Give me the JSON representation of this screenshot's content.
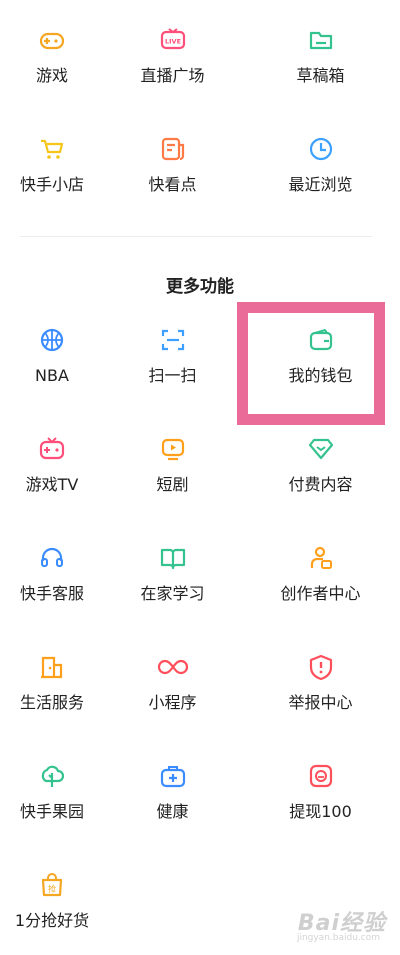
{
  "top_items": [
    {
      "label": "游戏",
      "icon": "gamepad-icon",
      "color": "#f5a623"
    },
    {
      "label": "直播广场",
      "icon": "live-icon",
      "color": "#ff4f7b"
    },
    {
      "label": "草稿箱",
      "icon": "folder-icon",
      "color": "#34c38f"
    },
    {
      "label": "快手小店",
      "icon": "cart-icon",
      "color": "#f5c518"
    },
    {
      "label": "快看点",
      "icon": "news-icon",
      "color": "#ff7a45"
    },
    {
      "label": "最近浏览",
      "icon": "clock-icon",
      "color": "#3ba0ff"
    }
  ],
  "section_title": "更多功能",
  "more_items": [
    {
      "label": "NBA",
      "icon": "basketball-icon",
      "color": "#3b8cff"
    },
    {
      "label": "扫一扫",
      "icon": "scan-icon",
      "color": "#3ba0ff"
    },
    {
      "label": "我的钱包",
      "icon": "wallet-icon",
      "color": "#34c38f"
    },
    {
      "label": "游戏TV",
      "icon": "tv-gamepad-icon",
      "color": "#ff4f7b"
    },
    {
      "label": "短剧",
      "icon": "play-screen-icon",
      "color": "#ff9f1c"
    },
    {
      "label": "付费内容",
      "icon": "diamond-icon",
      "color": "#34c38f"
    },
    {
      "label": "快手客服",
      "icon": "headset-icon",
      "color": "#3b8cff"
    },
    {
      "label": "在家学习",
      "icon": "book-icon",
      "color": "#34c38f"
    },
    {
      "label": "创作者中心",
      "icon": "creator-icon",
      "color": "#ff9f1c"
    },
    {
      "label": "生活服务",
      "icon": "shop-icon",
      "color": "#ff9f1c"
    },
    {
      "label": "小程序",
      "icon": "infinity-icon",
      "color": "#ff4f5a"
    },
    {
      "label": "举报中心",
      "icon": "shield-icon",
      "color": "#ff4f5a"
    },
    {
      "label": "快手果园",
      "icon": "tree-icon",
      "color": "#34c38f"
    },
    {
      "label": "健康",
      "icon": "medkit-icon",
      "color": "#3b8cff"
    },
    {
      "label": "提现100",
      "icon": "withdraw-icon",
      "color": "#ff4f5a"
    },
    {
      "label": "1分抢好货",
      "icon": "grab-bag-icon",
      "color": "#f5a623"
    }
  ],
  "highlight_color": "#ea6b98",
  "watermark": {
    "text": "Bai经验",
    "sub": "jingyan.baidu.com"
  }
}
